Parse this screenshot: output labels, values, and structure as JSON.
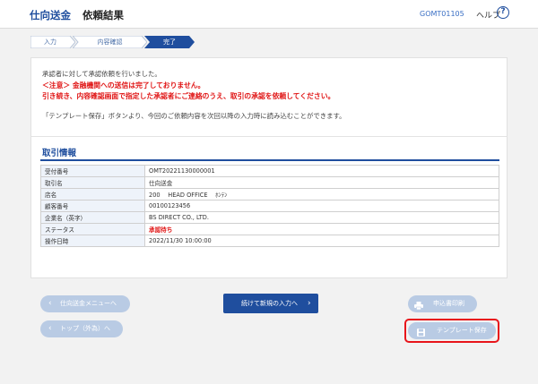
{
  "header": {
    "app_title": "仕向送金",
    "page_title": "依頼結果",
    "screen_id": "GOMT01105",
    "help_label": "ヘルプ",
    "help_glyph": "?"
  },
  "steps": [
    {
      "label": "入力",
      "state": "done"
    },
    {
      "label": "内容確認",
      "state": "done"
    },
    {
      "label": "完了",
      "state": "current"
    }
  ],
  "messages": {
    "line1": "承認者に対して承認依頼を行いました。",
    "warn1": "＜注意＞ 金融機関への送信は完了しておりません。",
    "warn2": "引き続き、内容確認画面で指定した承認者にご連絡のうえ、取引の承認を依頼してください。",
    "line2": "「テンプレート保存」ボタンより、今回のご依頼内容を次回以降の入力時に読み込むことができます。"
  },
  "section": {
    "title": "取引情報",
    "rows": [
      {
        "key": "受付番号",
        "value": "OMT20221130000001"
      },
      {
        "key": "取引名",
        "value": "仕向送金"
      },
      {
        "key": "店名",
        "value": "200　 HEAD OFFICE　 ﾎﾝﾃﾝ"
      },
      {
        "key": "顧客番号",
        "value": "00100123456"
      },
      {
        "key": "企業名（英字）",
        "value": "BS DIRECT CO., LTD."
      },
      {
        "key": "ステータス",
        "value": "承認待ち"
      },
      {
        "key": "操作日時",
        "value": "2022/11/30 10:00:00"
      }
    ]
  },
  "buttons": {
    "menu": "仕向送金メニューへ",
    "top": "トップ（外為）へ",
    "continue": "続けて新規の入力へ",
    "print": "申込書印刷",
    "template_save": "テンプレート保存",
    "back_glyph": "‹",
    "next_glyph": "›"
  },
  "colors": {
    "brand": "#1f4e9e",
    "warning": "#e01414",
    "highlight": "#e8151b",
    "disabled_button": "#b9cbe4"
  }
}
